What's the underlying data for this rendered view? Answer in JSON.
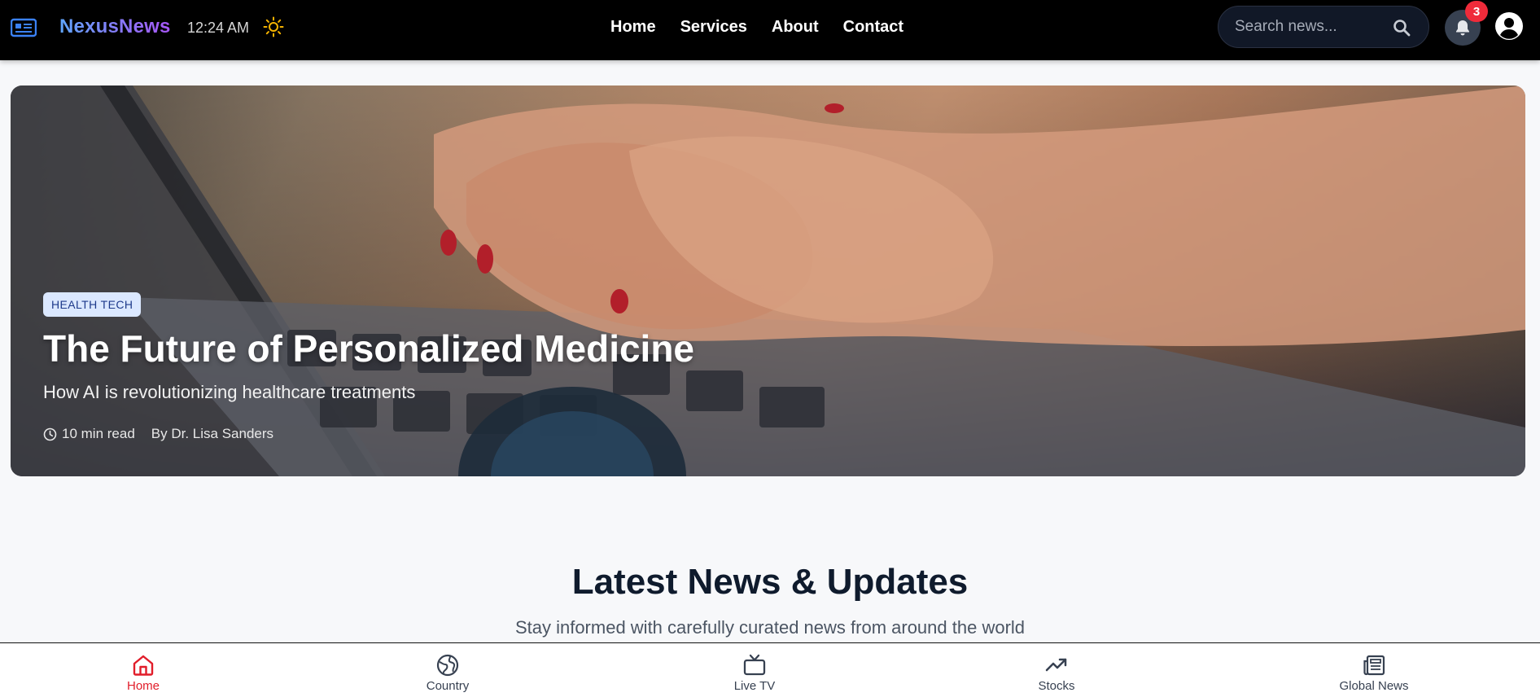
{
  "header": {
    "brand": "NexusNews",
    "time": "12:24 AM",
    "nav": [
      "Home",
      "Services",
      "About",
      "Contact"
    ],
    "search_placeholder": "Search news...",
    "notification_count": "3"
  },
  "hero": {
    "tag": "HEALTH TECH",
    "title": "The Future of Personalized Medicine",
    "subtitle": "How AI is revolutionizing healthcare treatments",
    "read_time": "10 min read",
    "author": "By Dr. Lisa Sanders"
  },
  "section": {
    "title": "Latest News & Updates",
    "subtitle": "Stay informed with carefully curated news from around the world"
  },
  "bottom_nav": [
    {
      "label": "Home",
      "icon": "home-icon",
      "active": true
    },
    {
      "label": "Country",
      "icon": "globe-icon",
      "active": false
    },
    {
      "label": "Live TV",
      "icon": "tv-icon",
      "active": false
    },
    {
      "label": "Stocks",
      "icon": "trending-up-icon",
      "active": false
    },
    {
      "label": "Global News",
      "icon": "newspaper-icon",
      "active": false
    }
  ],
  "colors": {
    "brand_gradient": [
      "#60a5fa",
      "#a855f7"
    ],
    "active_nav": "#e11d2a",
    "badge": "#ef2b3a",
    "tag_bg": "#dbe8ff"
  }
}
